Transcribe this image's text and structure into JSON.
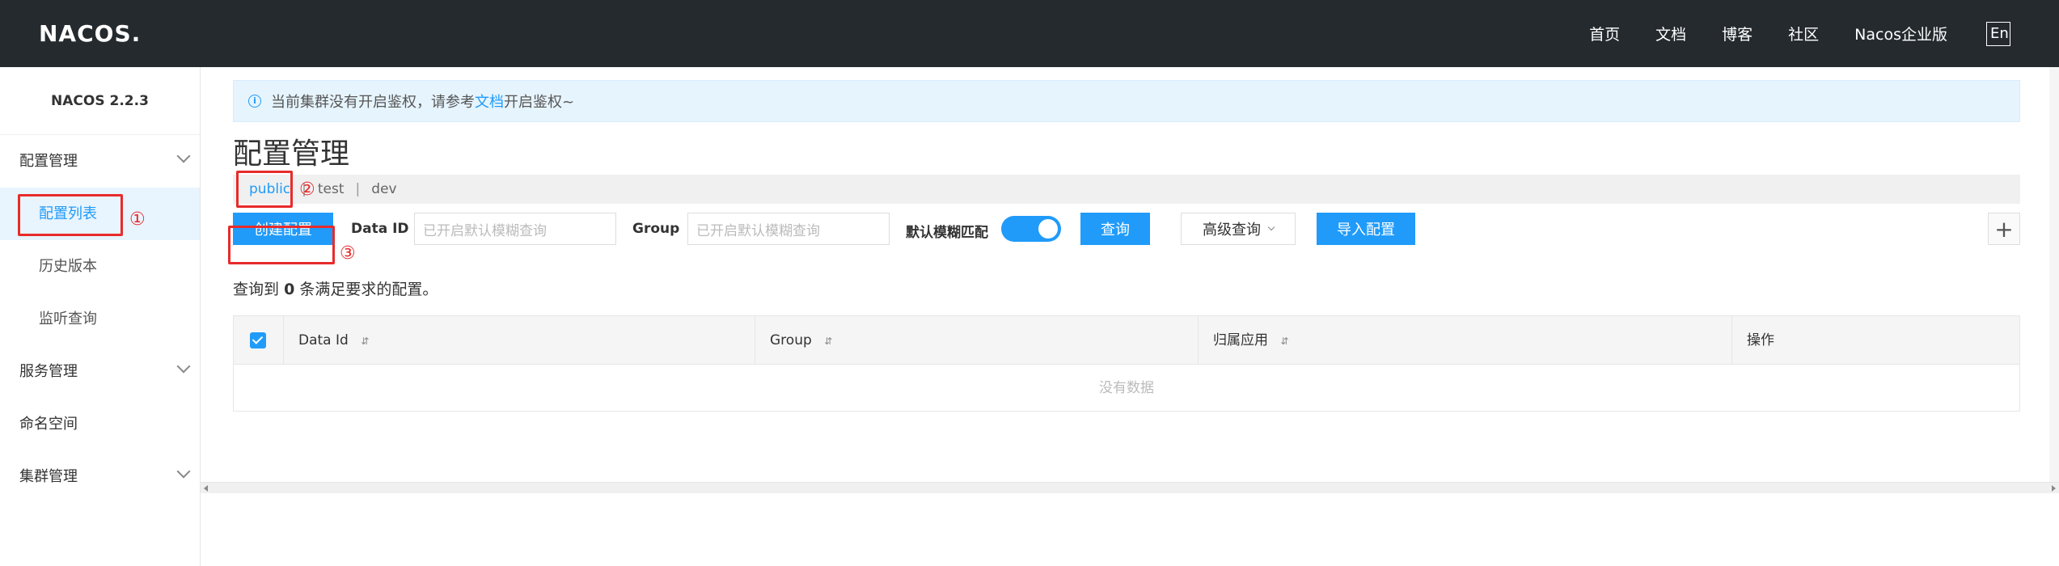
{
  "header": {
    "logo": "NACOS.",
    "nav": [
      "首页",
      "文档",
      "博客",
      "社区",
      "Nacos企业版"
    ],
    "lang": "En"
  },
  "sidebar": {
    "version": "NACOS 2.2.3",
    "items": [
      {
        "label": "配置管理",
        "expandable": true
      },
      {
        "label": "配置列表",
        "active": true
      },
      {
        "label": "历史版本"
      },
      {
        "label": "监听查询"
      },
      {
        "label": "服务管理",
        "expandable": true
      },
      {
        "label": "命名空间"
      },
      {
        "label": "集群管理",
        "expandable": true
      }
    ]
  },
  "notice": {
    "before": "当前集群没有开启鉴权，请参考",
    "link": "文档",
    "after": "开启鉴权~"
  },
  "page_title": "配置管理",
  "namespaces": [
    "public",
    "test",
    "dev"
  ],
  "toolbar": {
    "create_button": "创建配置",
    "data_id_label": "Data ID",
    "data_id_placeholder": "已开启默认模糊查询",
    "group_label": "Group",
    "group_placeholder": "已开启默认模糊查询",
    "fuzzy_label": "默认模糊匹配",
    "fuzzy_enabled": true,
    "query_button": "查询",
    "advanced_button": "高级查询",
    "import_button": "导入配置",
    "plus": "+"
  },
  "result": {
    "prefix": "查询到",
    "count": "0",
    "suffix": "条满足要求的配置。"
  },
  "table": {
    "columns": [
      "Data Id",
      "Group",
      "归属应用",
      "操作"
    ],
    "empty_text": "没有数据"
  },
  "annotations": [
    "①",
    "②",
    "③"
  ],
  "colors": {
    "primary": "#209bfa",
    "header_bg": "#252a2f",
    "annotation": "#e82b2b"
  }
}
